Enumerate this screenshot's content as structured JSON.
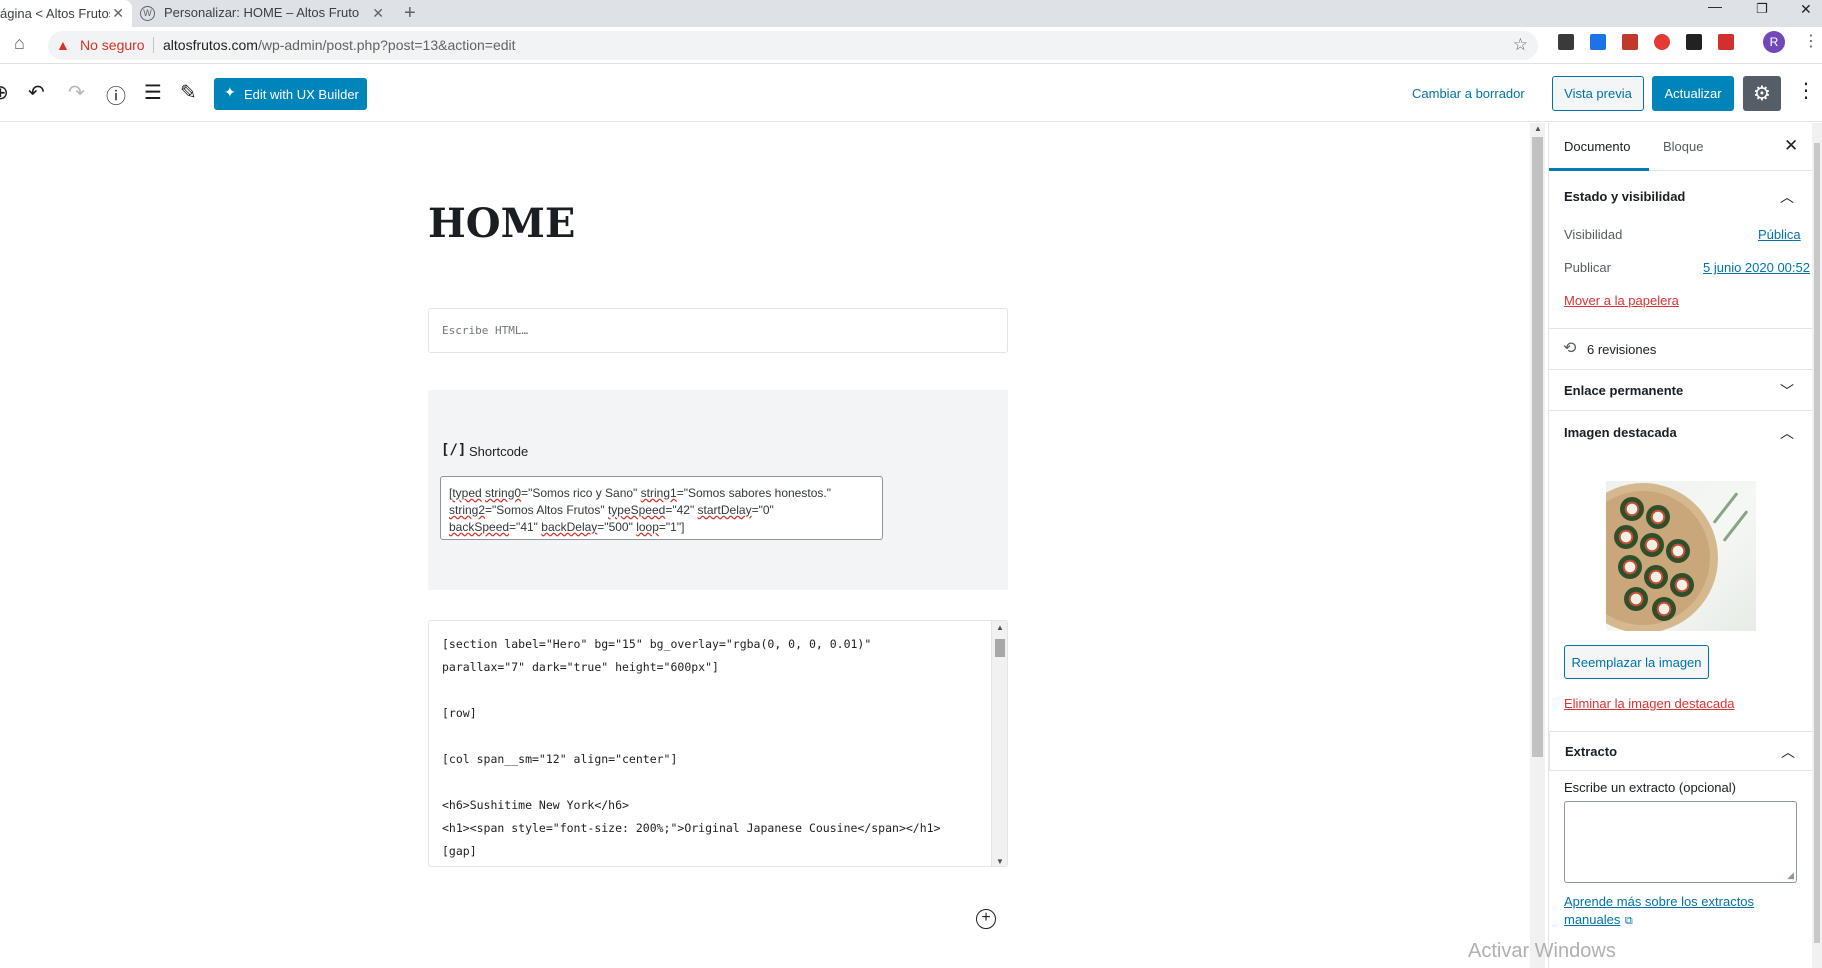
{
  "browser": {
    "tabs": [
      {
        "title": "ágina < Altos Frutos | S"
      },
      {
        "title": "Personalizar: HOME – Altos Fruto"
      }
    ],
    "new_tab": "+",
    "security_label": "No seguro",
    "url_domain": "altosfrutos.com",
    "url_path": "/wp-admin/post.php?post=13&action=edit",
    "profile_initial": "R"
  },
  "toolbar": {
    "ux_builder_label": "Edit with UX Builder",
    "draft_link": "Cambiar a borrador",
    "preview_label": "Vista previa",
    "update_label": "Actualizar"
  },
  "editor": {
    "title": "HOME",
    "html_placeholder": "Escribe HTML…",
    "shortcode": {
      "icon": "[/]",
      "label": "Shortcode",
      "text_parts": [
        "[",
        "typed",
        " ",
        "string0",
        "=\"Somos rico y Sano\" ",
        "string1",
        "=\"Somos sabores honestos.\" ",
        "string2",
        "=\"Somos Altos Frutos\" ",
        "typeSpeed",
        "=\"42\" ",
        "startDelay",
        "=\"0\" ",
        "backSpeed",
        "=\"41\" ",
        "backDelay",
        "=\"500\" ",
        "loop",
        "=\"1\"]"
      ]
    },
    "code_text": "[section label=\"Hero\" bg=\"15\" bg_overlay=\"rgba(0, 0, 0, 0.01)\"\nparallax=\"7\" dark=\"true\" height=\"600px\"]\n\n[row]\n\n[col span__sm=\"12\" align=\"center\"]\n\n<h6>Sushitime New York</h6>\n<h1><span style=\"font-size: 200%;\">Original Japanese Cousine</span></h1>\n[gap]"
  },
  "sidebar": {
    "tab_document": "Documento",
    "tab_block": "Bloque",
    "status_panel": {
      "title": "Estado y visibilidad",
      "visibility_label": "Visibilidad",
      "visibility_value": "Pública",
      "publish_label": "Publicar",
      "publish_value": "5 junio 2020 00:52",
      "trash_link": "Mover a la papelera"
    },
    "revisions": "6 revisiones",
    "permalink_title": "Enlace permanente",
    "featured_image": {
      "title": "Imagen destacada",
      "replace_label": "Reemplazar la imagen",
      "remove_link": "Eliminar la imagen destacada"
    },
    "excerpt": {
      "title": "Extracto",
      "label": "Escribe un extracto (opcional)",
      "help_link": "Aprende más sobre los extractos manuales"
    }
  },
  "watermark": "Activar Windows",
  "colors": {
    "primary": "#0085ba",
    "link": "#0073aa",
    "danger": "#dc3232",
    "insecure": "#d93025",
    "avatar": "#7248b9"
  }
}
